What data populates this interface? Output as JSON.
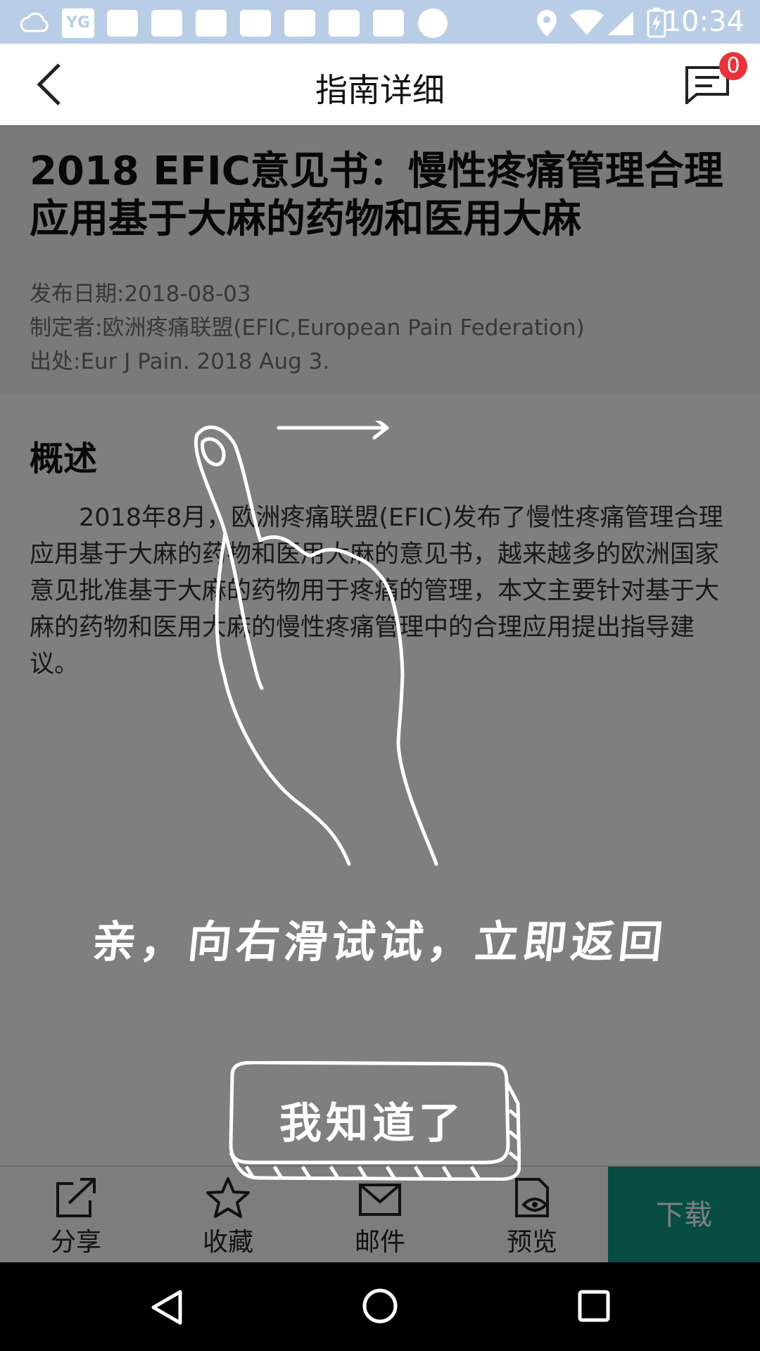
{
  "status_bar": {
    "time": "10:34"
  },
  "header": {
    "title": "指南详细",
    "badge_count": "0"
  },
  "document": {
    "title": "2018 EFIC意见书：慢性疼痛管理合理应用基于大麻的药物和医用大麻",
    "publish_date": "发布日期:2018-08-03",
    "author": "制定者:欧洲疼痛联盟(EFIC,European Pain Federation)",
    "source": "出处:Eur J Pain. 2018 Aug 3.",
    "section_title": "概述",
    "summary": "2018年8月，欧洲疼痛联盟(EFIC)发布了慢性疼痛管理合理应用基于大麻的药物和医用大麻的意见书，越来越多的欧洲国家意见批准基于大麻的药物用于疼痛的管理，本文主要针对基于大麻的药物和医用大麻的慢性疼痛管理中的合理应用提出指导建议。"
  },
  "toolbar": {
    "share": "分享",
    "favorite": "收藏",
    "email": "邮件",
    "preview": "预览",
    "download": "下载"
  },
  "overlay": {
    "hint": "亲，向右滑试试，立即返回",
    "button": "我知道了"
  },
  "colors": {
    "accent": "#0e9a86",
    "badge": "#e8333a",
    "status_bar": "#b9cde6"
  }
}
